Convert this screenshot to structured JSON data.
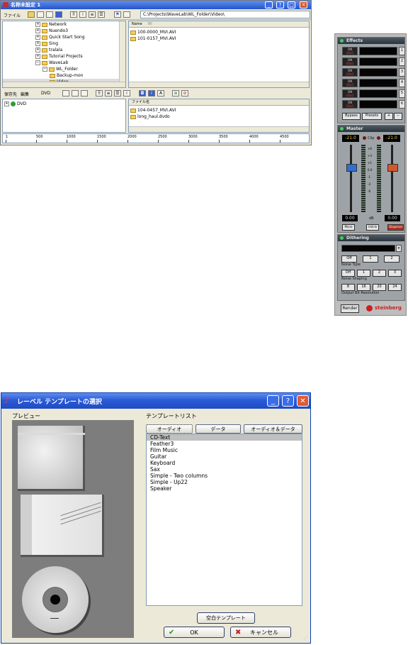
{
  "window1": {
    "title": "名称未設定 1",
    "buttons": {
      "minimize": "_",
      "help": "?",
      "maximize": "□",
      "close": "✕"
    },
    "menu": {
      "file": "ファイル"
    },
    "path": "C:\\Projects\\WaveLab\\WL_Folder\\Video\\",
    "tree": [
      {
        "label": "Network",
        "level": 0,
        "expander": "+"
      },
      {
        "label": "Nuendo3",
        "level": 0,
        "expander": "+"
      },
      {
        "label": "Quick Start Song",
        "level": 0,
        "expander": "+"
      },
      {
        "label": "Sing",
        "level": 0,
        "expander": "+"
      },
      {
        "label": "tralala",
        "level": 0,
        "expander": "+"
      },
      {
        "label": "Tutorial Projects",
        "level": 0,
        "expander": "+"
      },
      {
        "label": "WaveLab",
        "level": 0,
        "expander": "−"
      },
      {
        "label": "WL_Folder",
        "level": 1,
        "expander": "−"
      },
      {
        "label": "Backup-mon",
        "level": 2,
        "expander": ""
      },
      {
        "label": "Video",
        "level": 2,
        "expander": "",
        "selected": true
      }
    ],
    "file_header": {
      "name": "Name",
      "extra": "WI"
    },
    "files": [
      "100-0000_MVI.AVI",
      "101-0157_MVI.AVI"
    ],
    "lower_menu": {
      "save_to": "保存先",
      "edit": "編集",
      "dvd": "DVD"
    },
    "lower_tree": [
      {
        "label": "DVD",
        "expander": "+"
      }
    ],
    "lower_file_header": "ファイル名",
    "lower_files": [
      "104-0457_MVI.AVI",
      "long_haul.dvdo"
    ],
    "ruler_labels": [
      "1",
      "500",
      "1000",
      "1500",
      "2000",
      "2500",
      "3000",
      "3500",
      "4000",
      "4500"
    ]
  },
  "panel": {
    "effects": {
      "title": "Effects",
      "slots": [
        {
          "on": "ON",
          "mode": "SOLO",
          "num": "1"
        },
        {
          "on": "ON",
          "mode": "SOLO",
          "num": "2"
        },
        {
          "on": "ON",
          "mode": "SOLO",
          "num": "3"
        },
        {
          "on": "ON",
          "mode": "SOLO",
          "num": "4"
        },
        {
          "on": "ON",
          "mode": "SOLO",
          "num": "5"
        },
        {
          "on": "ON",
          "mode": "SOLO",
          "num": "6"
        }
      ],
      "bypass": "Bypass",
      "presets": "Presets",
      "plus": "+",
      "minus": "−"
    },
    "master": {
      "title": "Master",
      "left_value": "-21.0",
      "right_value": "-21.0",
      "clip_label": "Clip",
      "scale": [
        "+6",
        "+3",
        "+1",
        "0.0",
        "-1",
        "-3",
        "-6"
      ],
      "left_out": "0.00",
      "right_out": "0.00",
      "db_label": "dB",
      "mono": "Mono",
      "unlink": "Unlink",
      "dispersal": "Dispersal",
      "left_level": 0.72,
      "right_level": 0.72
    },
    "dithering": {
      "title": "Dithering",
      "row1": [
        "Off",
        "1",
        "2"
      ],
      "row1_label": "Noise Type",
      "row2": [
        "Off",
        "1",
        "2",
        "3"
      ],
      "row2_label": "Noise Shaping",
      "row3": [
        "8",
        "16",
        "20",
        "24"
      ],
      "row3_label": "Output Bit Resolution"
    },
    "render": "Render",
    "brand": "steinberg"
  },
  "window2": {
    "title": "レーベル テンプレートの選択",
    "buttons": {
      "minimize": "_",
      "help": "?",
      "close": "✕"
    },
    "preview_label": "プレビュー",
    "template_label": "テンプレートリスト",
    "tabs": [
      "オーディオ",
      "データ",
      "オーディオ＆データ"
    ],
    "templates": [
      "CD-Text",
      "Feather3",
      "Film Music",
      "Guitar",
      "Keyboard",
      "Sax",
      "Simple - Two columns",
      "Simple - Up22",
      "Speaker"
    ],
    "selected_template": "CD-Text",
    "blank_template": "空白テンプレート",
    "ok": "OK",
    "cancel": "キャンセル"
  },
  "colors": {
    "xp_title": "#2455c9",
    "xp_face": "#ece9d8",
    "panel_bg": "#bdbdbd",
    "fader_blue": "#2f6fd0",
    "fader_red": "#d0582f"
  }
}
